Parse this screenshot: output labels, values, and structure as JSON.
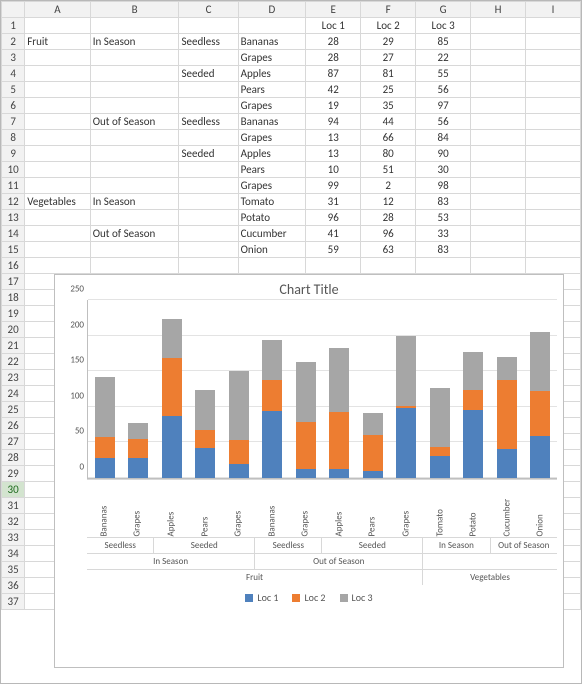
{
  "columns": [
    "A",
    "B",
    "C",
    "D",
    "E",
    "F",
    "G",
    "H",
    "I"
  ],
  "row_count": 37,
  "selected_row": 30,
  "headers": {
    "loc1": "Loc 1",
    "loc2": "Loc 2",
    "loc3": "Loc 3"
  },
  "rows": [
    {
      "A": "",
      "B": "",
      "C": "",
      "D": "",
      "E": "Loc 1",
      "F": "Loc 2",
      "G": "Loc 3"
    },
    {
      "A": "Fruit",
      "B": "In Season",
      "C": "Seedless",
      "D": "Bananas",
      "E": 28,
      "F": 29,
      "G": 85
    },
    {
      "A": "",
      "B": "",
      "C": "",
      "D": "Grapes",
      "E": 28,
      "F": 27,
      "G": 22
    },
    {
      "A": "",
      "B": "",
      "C": "Seeded",
      "D": "Apples",
      "E": 87,
      "F": 81,
      "G": 55
    },
    {
      "A": "",
      "B": "",
      "C": "",
      "D": "Pears",
      "E": 42,
      "F": 25,
      "G": 56
    },
    {
      "A": "",
      "B": "",
      "C": "",
      "D": "Grapes",
      "E": 19,
      "F": 35,
      "G": 97
    },
    {
      "A": "",
      "B": "Out of Season",
      "C": "Seedless",
      "D": "Bananas",
      "E": 94,
      "F": 44,
      "G": 56
    },
    {
      "A": "",
      "B": "",
      "C": "",
      "D": "Grapes",
      "E": 13,
      "F": 66,
      "G": 84
    },
    {
      "A": "",
      "B": "",
      "C": "Seeded",
      "D": "Apples",
      "E": 13,
      "F": 80,
      "G": 90
    },
    {
      "A": "",
      "B": "",
      "C": "",
      "D": "Pears",
      "E": 10,
      "F": 51,
      "G": 30
    },
    {
      "A": "",
      "B": "",
      "C": "",
      "D": "Grapes",
      "E": 99,
      "F": 2,
      "G": 98
    },
    {
      "A": "Vegetables",
      "B": "In Season",
      "C": "",
      "D": "Tomato",
      "E": 31,
      "F": 12,
      "G": 83
    },
    {
      "A": "",
      "B": "",
      "C": "",
      "D": "Potato",
      "E": 96,
      "F": 28,
      "G": 53
    },
    {
      "A": "",
      "B": "Out of Season",
      "C": "",
      "D": "Cucumber",
      "E": 41,
      "F": 96,
      "G": 33
    },
    {
      "A": "",
      "B": "",
      "C": "",
      "D": "Onion",
      "E": 59,
      "F": 63,
      "G": 83
    }
  ],
  "chart_data": {
    "type": "bar",
    "stacked": true,
    "title": "Chart Title",
    "ylabel": "",
    "ylim": [
      0,
      250
    ],
    "yticks": [
      0,
      50,
      100,
      150,
      200,
      250
    ],
    "series": [
      {
        "name": "Loc 1",
        "color": "#4f81bd",
        "values": [
          28,
          28,
          87,
          42,
          19,
          94,
          13,
          13,
          10,
          99,
          31,
          96,
          41,
          59
        ]
      },
      {
        "name": "Loc 2",
        "color": "#ed7d31",
        "values": [
          29,
          27,
          81,
          25,
          35,
          44,
          66,
          80,
          51,
          2,
          12,
          28,
          96,
          63
        ]
      },
      {
        "name": "Loc 3",
        "color": "#a6a6a6",
        "values": [
          85,
          22,
          55,
          56,
          97,
          56,
          84,
          90,
          30,
          98,
          83,
          53,
          33,
          83
        ]
      }
    ],
    "categories": {
      "tier3_items": [
        "Bananas",
        "Grapes",
        "Apples",
        "Pears",
        "Grapes",
        "Bananas",
        "Grapes",
        "Apples",
        "Pears",
        "Grapes",
        "Tomato",
        "Potato",
        "Cucumber",
        "Onion"
      ],
      "tier2_groups": [
        {
          "label": "Seedless",
          "span": 2
        },
        {
          "label": "Seeded",
          "span": 3
        },
        {
          "label": "Seedless",
          "span": 2
        },
        {
          "label": "Seeded",
          "span": 3
        },
        {
          "label": "In Season",
          "span": 2
        },
        {
          "label": "Out of Season",
          "span": 2
        }
      ],
      "tier1_groups": [
        {
          "label": "In Season",
          "span": 5
        },
        {
          "label": "Out of Season",
          "span": 5
        },
        {
          "label": "",
          "span": 4
        }
      ],
      "tier0_groups": [
        {
          "label": "Fruit",
          "span": 10
        },
        {
          "label": "Vegetables",
          "span": 4
        }
      ]
    }
  }
}
